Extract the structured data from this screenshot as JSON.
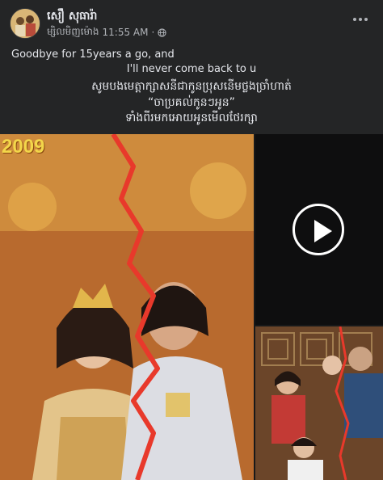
{
  "post": {
    "author": "សឿ សុធារ៉ា",
    "timestamp_prefix": "ម្សិលមិញម៉ោង",
    "time": "11:55 AM",
    "separator": "·",
    "privacy_icon": "globe-icon",
    "more_icon": "more-dots-icon"
  },
  "content": {
    "line1": "Goodbye for 15years a go, and",
    "line2": "I'll never come back to u",
    "khmer_line1": "សូមបងមេត្តាក្សាសនីជាកូនប្រុសនើមថ្លងច្រាំហាត់",
    "khmer_line2": "“ចាប្រគល់កូនៗអូន”",
    "khmer_line3": "ទាំងពីរមកអោយអូនមើលថែរក្សា"
  },
  "media": {
    "photo_year": "2009",
    "play_icon": "play-icon"
  },
  "colors": {
    "background": "#242526",
    "text_primary": "#e4e6eb",
    "text_secondary": "#b0b3b8",
    "tear_line": "#e8392b",
    "year_text": "#f3d64a"
  }
}
